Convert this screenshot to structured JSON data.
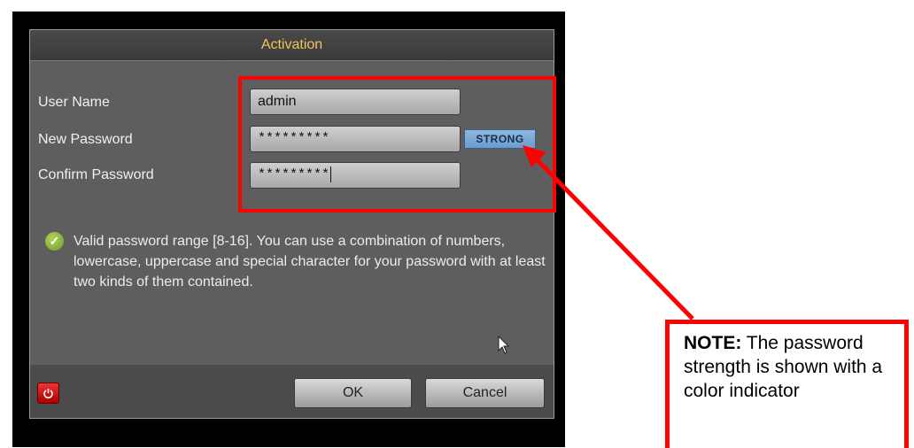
{
  "dialog": {
    "title": "Activation",
    "username_label": "User Name",
    "username_value": "admin",
    "new_password_label": "New Password",
    "new_password_value": "*********",
    "confirm_password_label": "Confirm Password",
    "confirm_password_value": "*********",
    "strength_label": "STRONG",
    "hint": "Valid password range [8-16]. You can use a combination of numbers, lowercase, uppercase and special character for your password with at least two kinds of them contained.",
    "ok_label": "OK",
    "cancel_label": "Cancel"
  },
  "note": {
    "bold": "NOTE:",
    "text": " The password strength is shown with a color indicator"
  },
  "colors": {
    "highlight": "#ff0000",
    "title_text": "#f2c45a",
    "strength_indicator": "#7aaad6"
  },
  "icons": [
    "check-icon",
    "power-icon",
    "mouse-pointer-icon",
    "arrow-annotation"
  ]
}
